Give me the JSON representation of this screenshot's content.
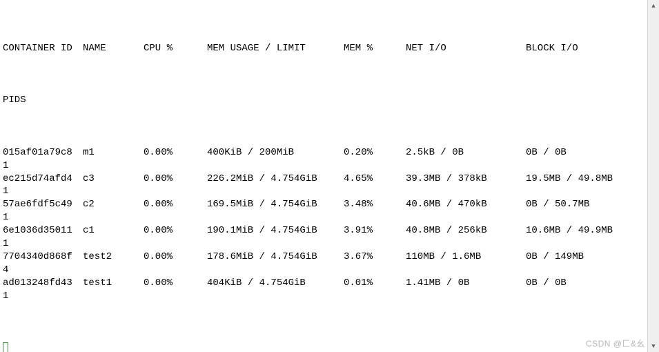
{
  "headers": {
    "container_id": "CONTAINER ID",
    "name": "NAME",
    "cpu": "CPU %",
    "mem_usage_limit": "MEM USAGE / LIMIT",
    "mem_pct": "MEM %",
    "net_io": "NET I/O",
    "block_io": "BLOCK I/O",
    "pids": "PIDS"
  },
  "rows": [
    {
      "id": "015af01a79c8",
      "name": "m1",
      "cpu": "0.00%",
      "mem": "400KiB / 200MiB",
      "mem_pct": "0.20%",
      "net": "2.5kB / 0B",
      "blk": "0B / 0B",
      "pids": "1"
    },
    {
      "id": "ec215d74afd4",
      "name": "c3",
      "cpu": "0.00%",
      "mem": "226.2MiB / 4.754GiB",
      "mem_pct": "4.65%",
      "net": "39.3MB / 378kB",
      "blk": "19.5MB / 49.8MB",
      "pids": "1"
    },
    {
      "id": "57ae6fdf5c49",
      "name": "c2",
      "cpu": "0.00%",
      "mem": "169.5MiB / 4.754GiB",
      "mem_pct": "3.48%",
      "net": "40.6MB / 470kB",
      "blk": "0B / 50.7MB",
      "pids": "1"
    },
    {
      "id": "6e1036d35011",
      "name": "c1",
      "cpu": "0.00%",
      "mem": "190.1MiB / 4.754GiB",
      "mem_pct": "3.91%",
      "net": "40.8MB / 256kB",
      "blk": "10.6MB / 49.9MB",
      "pids": "1"
    },
    {
      "id": "7704340d868f",
      "name": "test2",
      "cpu": "0.00%",
      "mem": "178.6MiB / 4.754GiB",
      "mem_pct": "3.67%",
      "net": "110MB / 1.6MB",
      "blk": "0B / 149MB",
      "pids": "4"
    },
    {
      "id": "ad013248fd43",
      "name": "test1",
      "cpu": "0.00%",
      "mem": "404KiB / 4.754GiB",
      "mem_pct": "0.01%",
      "net": "1.41MB / 0B",
      "blk": "0B / 0B",
      "pids": "1"
    }
  ],
  "watermark": "CSDN @匚&幺"
}
